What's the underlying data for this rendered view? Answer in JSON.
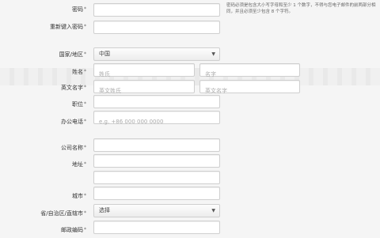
{
  "form": {
    "password": {
      "label": "密码",
      "required": "*",
      "value": ""
    },
    "password_hint": "密码必须是包含大小写字母和至少 1 个数字，不得与您电子邮件的前两部分相同，并且必须至少包含 8 个字符。",
    "confirm_password": {
      "label": "重新键入密码",
      "required": "*",
      "value": ""
    },
    "country": {
      "label": "国家/地区",
      "required": "*",
      "selected": "中国"
    },
    "name": {
      "label": "姓名",
      "required": "*",
      "last_placeholder": "姓氏",
      "first_placeholder": "名字"
    },
    "english_name": {
      "label": "英文名字",
      "required": "*",
      "last_placeholder": "英文姓氏",
      "first_placeholder": "英文名字"
    },
    "job_title": {
      "label": "职位",
      "required": "*",
      "value": ""
    },
    "office_phone": {
      "label": "办公电话",
      "required": "*",
      "placeholder": "e.g. +86 000 000 0000"
    },
    "company": {
      "label": "公司名称",
      "required": "*",
      "value": ""
    },
    "address": {
      "label": "地址",
      "required": "*",
      "value": "",
      "value2": ""
    },
    "city": {
      "label": "城市",
      "required": "*",
      "value": ""
    },
    "province": {
      "label": "省/自治区/直辖市",
      "required": "*",
      "selected": "选择"
    },
    "postal_code": {
      "label": "邮政编码",
      "required": "*",
      "value": ""
    }
  }
}
